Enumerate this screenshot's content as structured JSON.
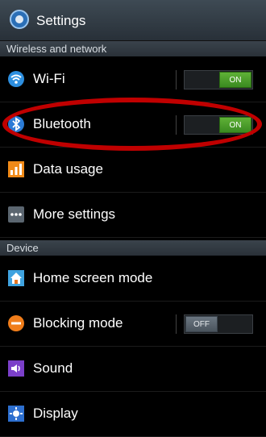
{
  "header": {
    "title": "Settings",
    "icon": "settings-gear-icon"
  },
  "sections": {
    "wireless": "Wireless and network",
    "device": "Device"
  },
  "items": {
    "wifi": {
      "label": "Wi-Fi",
      "icon": "wifi-icon",
      "toggle": "ON"
    },
    "bluetooth": {
      "label": "Bluetooth",
      "icon": "bluetooth-icon",
      "toggle": "ON"
    },
    "data_usage": {
      "label": "Data usage",
      "icon": "data-usage-icon"
    },
    "more": {
      "label": "More settings",
      "icon": "more-icon"
    },
    "home": {
      "label": "Home screen mode",
      "icon": "home-icon"
    },
    "blocking": {
      "label": "Blocking mode",
      "icon": "blocking-icon",
      "toggle": "OFF"
    },
    "sound": {
      "label": "Sound",
      "icon": "sound-icon"
    },
    "display": {
      "label": "Display",
      "icon": "display-icon"
    }
  },
  "colors": {
    "on": "#4aa02a",
    "highlight": "#c00000"
  }
}
